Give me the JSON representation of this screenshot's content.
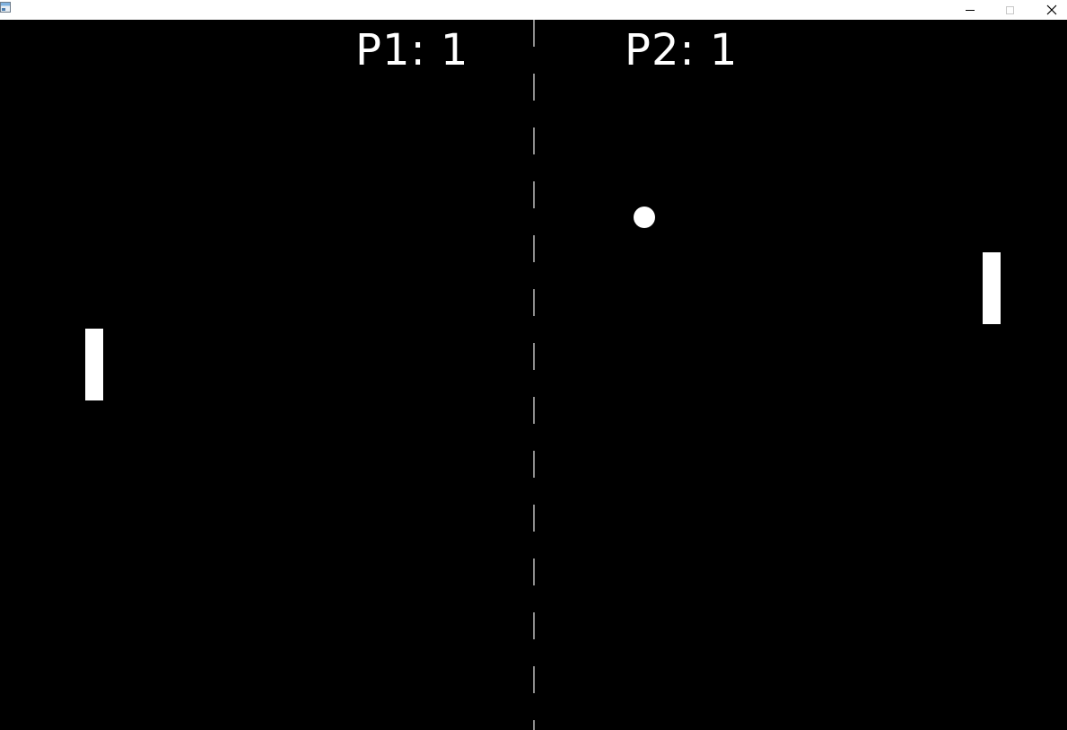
{
  "window": {
    "icon": "app-window-icon",
    "buttons": {
      "minimize": "minimize-icon",
      "maximize": "maximize-icon",
      "close": "close-icon"
    }
  },
  "scoreboard": {
    "p1": "P1: 1",
    "p2": "P2: 1"
  },
  "colors": {
    "background": "#000000",
    "foreground": "#ffffff",
    "net": "#8c8c8c"
  }
}
